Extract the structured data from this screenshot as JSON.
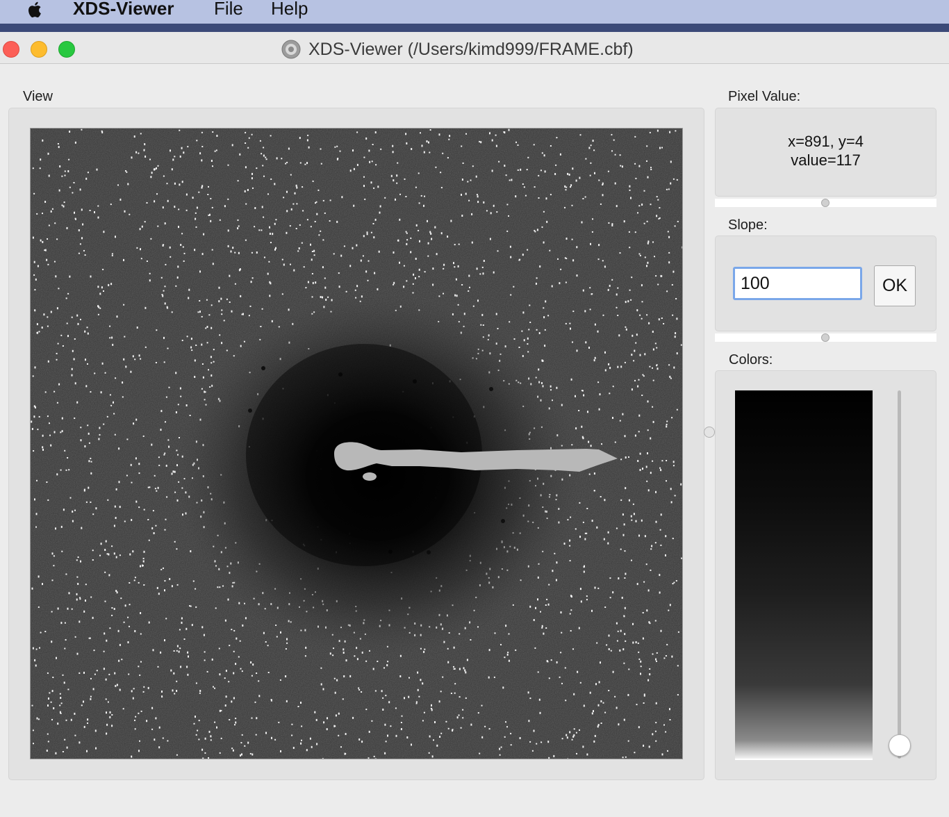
{
  "menubar": {
    "app_name": "XDS-Viewer",
    "items": [
      "File",
      "Help"
    ],
    "icon": "apple-icon"
  },
  "window": {
    "title": "XDS-Viewer (/Users/kimd999/FRAME.cbf)",
    "title_icon": "app-disc-icon"
  },
  "view": {
    "label": "View"
  },
  "pixel_value": {
    "label": "Pixel Value:",
    "coords": "x=891, y=4",
    "value": "value=117"
  },
  "slope": {
    "label": "Slope:",
    "value": "100",
    "ok_label": "OK"
  },
  "colors": {
    "label": "Colors:",
    "slider_level": 1.0
  },
  "palette": {
    "close": "#fc5f57",
    "minimize": "#fdbc2e",
    "maximize": "#28c840",
    "focus_ring": "#7aa7e9",
    "beamstop": "#b8b8b8"
  }
}
